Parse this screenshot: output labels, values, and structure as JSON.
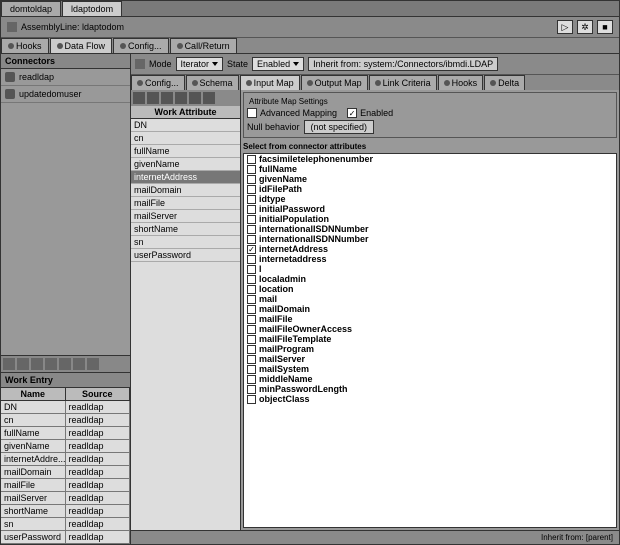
{
  "topTabs": [
    "domtoldap",
    "ldaptodom"
  ],
  "activeTopTab": 1,
  "assemblyLine": "AssemblyLine: ldaptodom",
  "subTabs": [
    "Hooks",
    "Data Flow",
    "Config...",
    "Call/Return"
  ],
  "activeSubTab": 1,
  "connectors": {
    "header": "Connectors",
    "items": [
      "readldap",
      "updatedomuser"
    ]
  },
  "workEntry": {
    "header": "Work Entry",
    "columns": [
      "Name",
      "Source"
    ],
    "rows": [
      [
        "DN",
        "readldap"
      ],
      [
        "cn",
        "readldap"
      ],
      [
        "fullName",
        "readldap"
      ],
      [
        "givenName",
        "readldap"
      ],
      [
        "internetAddre...",
        "readldap"
      ],
      [
        "mailDomain",
        "readldap"
      ],
      [
        "mailFile",
        "readldap"
      ],
      [
        "mailServer",
        "readldap"
      ],
      [
        "shortName",
        "readldap"
      ],
      [
        "sn",
        "readldap"
      ],
      [
        "userPassword",
        "readldap"
      ]
    ]
  },
  "modeRow": {
    "modeLabel": "Mode",
    "modeValue": "Iterator",
    "stateLabel": "State",
    "stateValue": "Enabled",
    "inheritBtn": "Inherit from:  system:/Connectors/ibmdi.LDAP"
  },
  "rightTabs": [
    "Config...",
    "Schema",
    "Input Map",
    "Output Map",
    "Link Criteria",
    "Hooks",
    "Delta"
  ],
  "activeRightTab": 2,
  "workAttr": {
    "header": "Work Attribute",
    "items": [
      "DN",
      "cn",
      "fullName",
      "givenName",
      "internetAddress",
      "mailDomain",
      "mailFile",
      "mailServer",
      "shortName",
      "sn",
      "userPassword"
    ],
    "selected": 4
  },
  "attrMap": {
    "fieldset": "Attribute Map Settings",
    "advanced": "Advanced Mapping",
    "enabled": "Enabled",
    "nullLabel": "Null behavior",
    "nullBtn": "(not specified)",
    "selectLabel": "Select from connector attributes",
    "attrs": [
      {
        "n": "facsimiletelephonenumber",
        "c": false
      },
      {
        "n": "fullName",
        "c": false
      },
      {
        "n": "givenName",
        "c": false
      },
      {
        "n": "idFilePath",
        "c": false
      },
      {
        "n": "idtype",
        "c": false
      },
      {
        "n": "initialPassword",
        "c": false
      },
      {
        "n": "initialPopulation",
        "c": false
      },
      {
        "n": "internationalISDNNumber",
        "c": false
      },
      {
        "n": "internationalISDNNumber",
        "c": false
      },
      {
        "n": "internetAddress",
        "c": true
      },
      {
        "n": "internetaddress",
        "c": false
      },
      {
        "n": "l",
        "c": false
      },
      {
        "n": "localadmin",
        "c": false
      },
      {
        "n": "location",
        "c": false
      },
      {
        "n": "mail",
        "c": false
      },
      {
        "n": "mailDomain",
        "c": false
      },
      {
        "n": "mailFile",
        "c": false
      },
      {
        "n": "mailFileOwnerAccess",
        "c": false
      },
      {
        "n": "mailFileTemplate",
        "c": false
      },
      {
        "n": "mailProgram",
        "c": false
      },
      {
        "n": "mailServer",
        "c": false
      },
      {
        "n": "mailSystem",
        "c": false
      },
      {
        "n": "middleName",
        "c": false
      },
      {
        "n": "minPasswordLength",
        "c": false
      },
      {
        "n": "objectClass",
        "c": false
      }
    ]
  },
  "footer": "Inherit from: [parent]"
}
